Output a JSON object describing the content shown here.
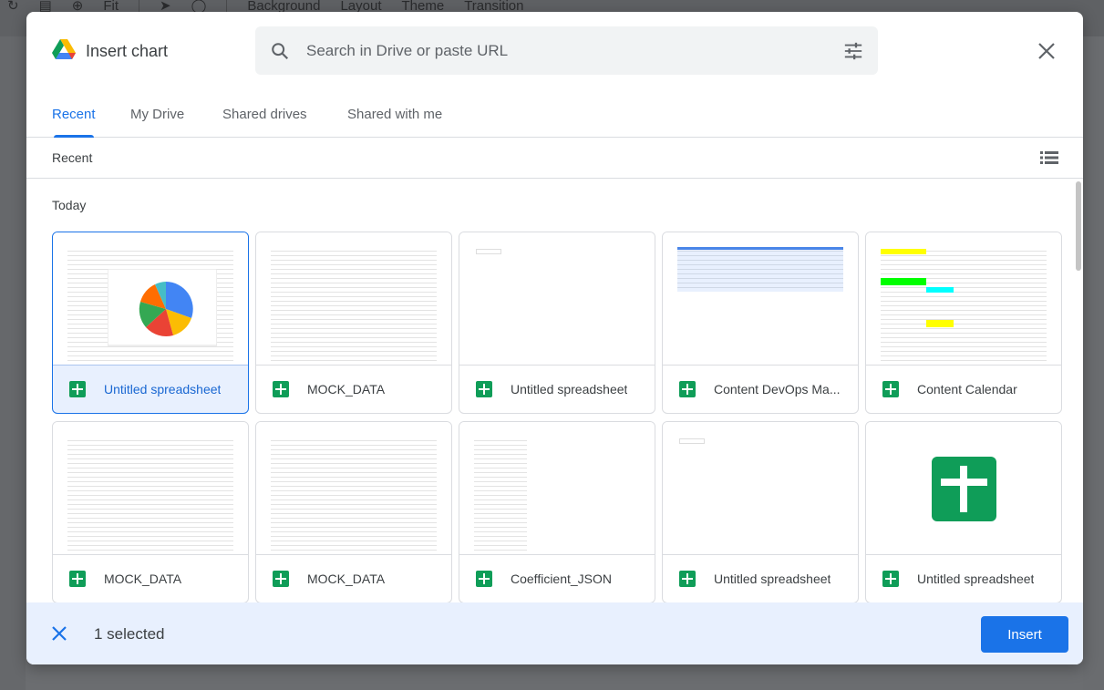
{
  "background_toolbar": {
    "zoom": "Fit",
    "items": [
      "Background",
      "Layout",
      "Theme",
      "Transition"
    ]
  },
  "dialog": {
    "title": "Insert chart",
    "search": {
      "placeholder": "Search in Drive or paste URL"
    },
    "tabs": [
      {
        "label": "Recent",
        "active": true
      },
      {
        "label": "My Drive"
      },
      {
        "label": "Shared drives"
      },
      {
        "label": "Shared with me"
      }
    ],
    "subbar_label": "Recent",
    "section": "Today",
    "files": [
      {
        "name": "Untitled spreadsheet",
        "thumb": "pie",
        "selected": true
      },
      {
        "name": "MOCK_DATA",
        "thumb": "sheet"
      },
      {
        "name": "Untitled spreadsheet",
        "thumb": "blank"
      },
      {
        "name": "Content DevOps Ma...",
        "thumb": "sheet-blue"
      },
      {
        "name": "Content Calendar",
        "thumb": "sheet-color"
      },
      {
        "name": "MOCK_DATA",
        "thumb": "sheet"
      },
      {
        "name": "MOCK_DATA",
        "thumb": "sheet"
      },
      {
        "name": "Coefficient_JSON",
        "thumb": "sheet-small"
      },
      {
        "name": "Untitled spreadsheet",
        "thumb": "blank"
      },
      {
        "name": "Untitled spreadsheet",
        "thumb": "icon"
      }
    ],
    "footer": {
      "selected_count": "1 selected",
      "insert_label": "Insert"
    },
    "colors": {
      "accent": "#1a73e8",
      "sheets_green": "#0f9d58",
      "footer_bg": "#e8f0fe"
    }
  }
}
